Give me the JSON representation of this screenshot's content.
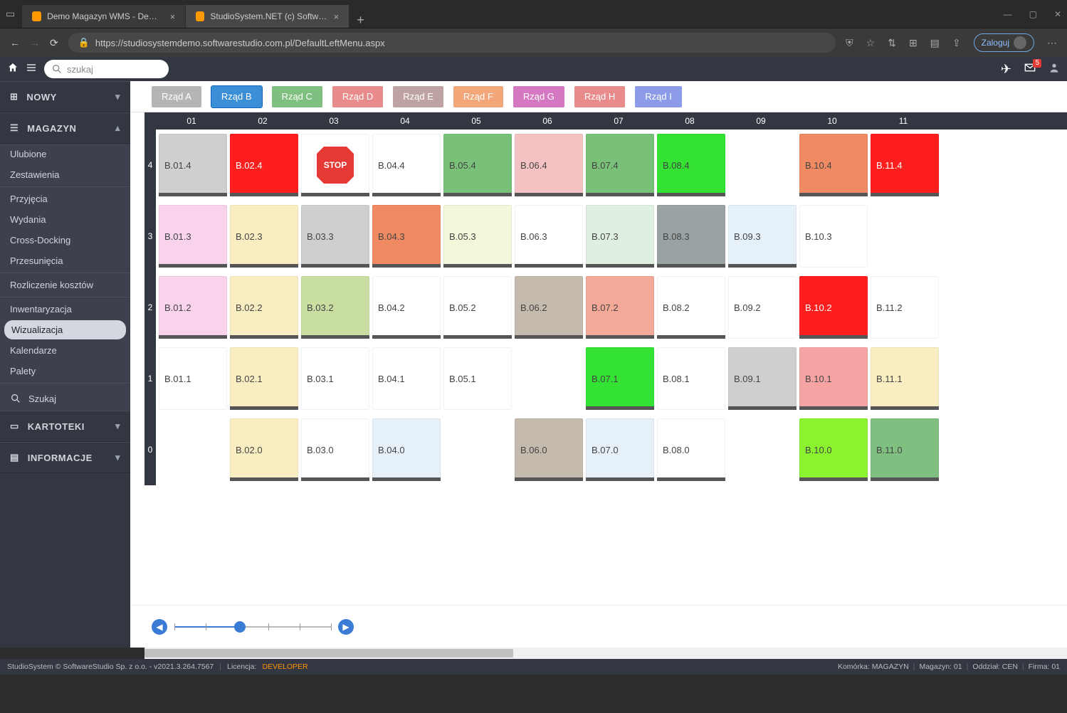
{
  "browser": {
    "tabs": [
      {
        "title": "Demo Magazyn WMS - Demo o..."
      },
      {
        "title": "StudioSystem.NET (c) SoftwareSt..."
      }
    ],
    "url": "https://studiosystemdemo.softwarestudio.com.pl/DefaultLeftMenu.aspx",
    "login_label": "Zaloguj"
  },
  "topbar": {
    "search_placeholder": "szukaj",
    "mail_badge": "5"
  },
  "sidebar": {
    "sections": {
      "nowy": "NOWY",
      "magazyn": "MAGAZYN",
      "kartoteki": "KARTOTEKI",
      "informacje": "INFORMACJE"
    },
    "items": [
      "Ulubione",
      "Zestawienia",
      "Przyjęcia",
      "Wydania",
      "Cross-Docking",
      "Przesunięcia",
      "Rozliczenie kosztów",
      "Inwentaryzacja",
      "Wizualizacja",
      "Kalendarze",
      "Palety",
      "Szukaj"
    ],
    "active_item_index": 8
  },
  "rowtabs": [
    {
      "label": "Rząd A",
      "color": "#b5b5b5"
    },
    {
      "label": "Rząd B",
      "color": "#3a8fd6",
      "active": true
    },
    {
      "label": "Rząd C",
      "color": "#7fbf7f"
    },
    {
      "label": "Rząd D",
      "color": "#e98b8b"
    },
    {
      "label": "Rząd E",
      "color": "#bfa3a3"
    },
    {
      "label": "Rząd F",
      "color": "#f2a679"
    },
    {
      "label": "Rząd G",
      "color": "#d478c1"
    },
    {
      "label": "Rząd H",
      "color": "#e98b8b"
    },
    {
      "label": "Rząd I",
      "color": "#8c9be8"
    }
  ],
  "columns": [
    "01",
    "02",
    "03",
    "04",
    "05",
    "06",
    "07",
    "08",
    "09",
    "10",
    "11"
  ],
  "rows": [
    {
      "label": "4",
      "cells": [
        {
          "label": "B.01.4",
          "bg": "#cfcfcf"
        },
        {
          "label": "B.02.4",
          "bg": "#ff1e1e",
          "fg": "#fff"
        },
        {
          "label": "STOP",
          "stop": true,
          "bg": "#ffffff"
        },
        {
          "label": "B.04.4",
          "bg": "#ffffff"
        },
        {
          "label": "B.05.4",
          "bg": "#79c179"
        },
        {
          "label": "B.06.4",
          "bg": "#f4c2c2"
        },
        {
          "label": "B.07.4",
          "bg": "#79c179"
        },
        {
          "label": "B.08.4",
          "bg": "#33e233"
        },
        {
          "label": "",
          "empty": true
        },
        {
          "label": "B.10.4",
          "bg": "#ef8a62"
        },
        {
          "label": "B.11.4",
          "bg": "#ff1e1e",
          "fg": "#fff"
        }
      ]
    },
    {
      "label": "3",
      "cells": [
        {
          "label": "B.01.3",
          "bg": "#f9d2ec"
        },
        {
          "label": "B.02.3",
          "bg": "#f9eec2"
        },
        {
          "label": "B.03.3",
          "bg": "#cfcfcf"
        },
        {
          "label": "B.04.3",
          "bg": "#ef8a62"
        },
        {
          "label": "B.05.3",
          "bg": "#f2f8d9"
        },
        {
          "label": "B.06.3",
          "bg": "#ffffff"
        },
        {
          "label": "B.07.3",
          "bg": "#e0f0e0"
        },
        {
          "label": "B.08.3",
          "bg": "#9aa3a3"
        },
        {
          "label": "B.09.3",
          "bg": "#e6f0f8"
        },
        {
          "label": "B.10.3",
          "bg": "#ffffff",
          "nobar": true
        },
        {
          "label": "",
          "empty": true
        }
      ]
    },
    {
      "label": "2",
      "cells": [
        {
          "label": "B.01.2",
          "bg": "#f9d2ec"
        },
        {
          "label": "B.02.2",
          "bg": "#f9eec2"
        },
        {
          "label": "B.03.2",
          "bg": "#c9dfa2"
        },
        {
          "label": "B.04.2",
          "bg": "#ffffff"
        },
        {
          "label": "B.05.2",
          "bg": "#ffffff"
        },
        {
          "label": "B.06.2",
          "bg": "#c5baae"
        },
        {
          "label": "B.07.2",
          "bg": "#f4a998"
        },
        {
          "label": "B.08.2",
          "bg": "#ffffff"
        },
        {
          "label": "B.09.2",
          "bg": "#ffffff",
          "nobar": true
        },
        {
          "label": "B.10.2",
          "bg": "#ff1e1e",
          "fg": "#fff"
        },
        {
          "label": "B.11.2",
          "bg": "#ffffff",
          "nobar": true
        }
      ]
    },
    {
      "label": "1",
      "cells": [
        {
          "label": "B.01.1",
          "bg": "#ffffff",
          "nobar": true
        },
        {
          "label": "B.02.1",
          "bg": "#f9eec2"
        },
        {
          "label": "B.03.1",
          "bg": "#ffffff",
          "nobar": true
        },
        {
          "label": "B.04.1",
          "bg": "#ffffff",
          "nobar": true
        },
        {
          "label": "B.05.1",
          "bg": "#ffffff",
          "nobar": true
        },
        {
          "label": "",
          "empty": true
        },
        {
          "label": "B.07.1",
          "bg": "#33e233"
        },
        {
          "label": "B.08.1",
          "bg": "#ffffff",
          "nobar": true
        },
        {
          "label": "B.09.1",
          "bg": "#cfcfcf"
        },
        {
          "label": "B.10.1",
          "bg": "#f5a3a3"
        },
        {
          "label": "B.11.1",
          "bg": "#f9eec2"
        }
      ]
    },
    {
      "label": "0",
      "cells": [
        {
          "label": "",
          "empty": true
        },
        {
          "label": "B.02.0",
          "bg": "#f9eec2"
        },
        {
          "label": "B.03.0",
          "bg": "#ffffff"
        },
        {
          "label": "B.04.0",
          "bg": "#e6f0f8"
        },
        {
          "label": "",
          "empty": true
        },
        {
          "label": "B.06.0",
          "bg": "#c5baae"
        },
        {
          "label": "B.07.0",
          "bg": "#e6f0f8"
        },
        {
          "label": "B.08.0",
          "bg": "#ffffff"
        },
        {
          "label": "",
          "empty": true
        },
        {
          "label": "B.10.0",
          "bg": "#8af22e"
        },
        {
          "label": "B.11.0",
          "bg": "#7fbf7f"
        }
      ]
    }
  ],
  "footer": {
    "left": "StudioSystem © SoftwareStudio Sp. z o.o. - v2021.3.264.7567",
    "license_label": "Licencja:",
    "license_value": "DEVELOPER",
    "right_parts": [
      "Komórka: MAGAZYN",
      "Magazyn: 01",
      "Oddział: CEN",
      "Firma: 01"
    ]
  }
}
